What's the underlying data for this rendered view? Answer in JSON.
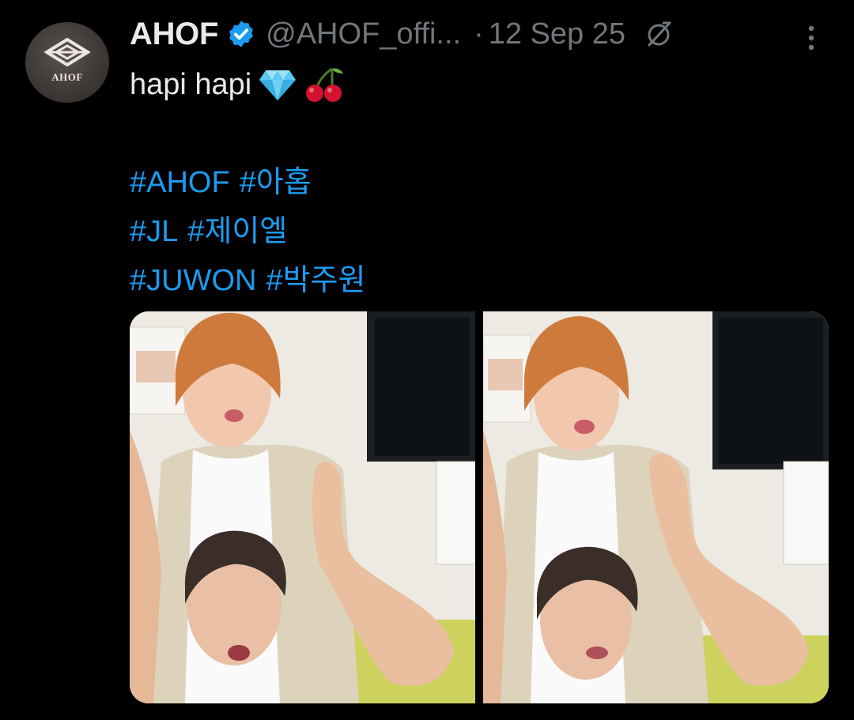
{
  "tweet": {
    "display_name": "AHOF",
    "handle": "@AHOF_offi...",
    "separator": "·",
    "date": "12 Sep 25",
    "avatar_text": "AHOF",
    "text_line1": "hapi hapi",
    "emojis": [
      "gem-emoji",
      "cherries-emoji"
    ],
    "hashtag_lines": [
      [
        "#AHOF",
        "#아홉"
      ],
      [
        "#JL",
        "#제이엘"
      ],
      [
        "#JUWON",
        "#박주원"
      ]
    ],
    "media_count": 2
  },
  "colors": {
    "background": "#000000",
    "text": "#e7e9ea",
    "secondary": "#71767b",
    "link": "#1d9bf0",
    "verified": "#1d9bf0"
  },
  "icons": {
    "verified": "verified-badge-icon",
    "visibility": "hidden-reply-icon",
    "more": "more-vertical-icon"
  }
}
